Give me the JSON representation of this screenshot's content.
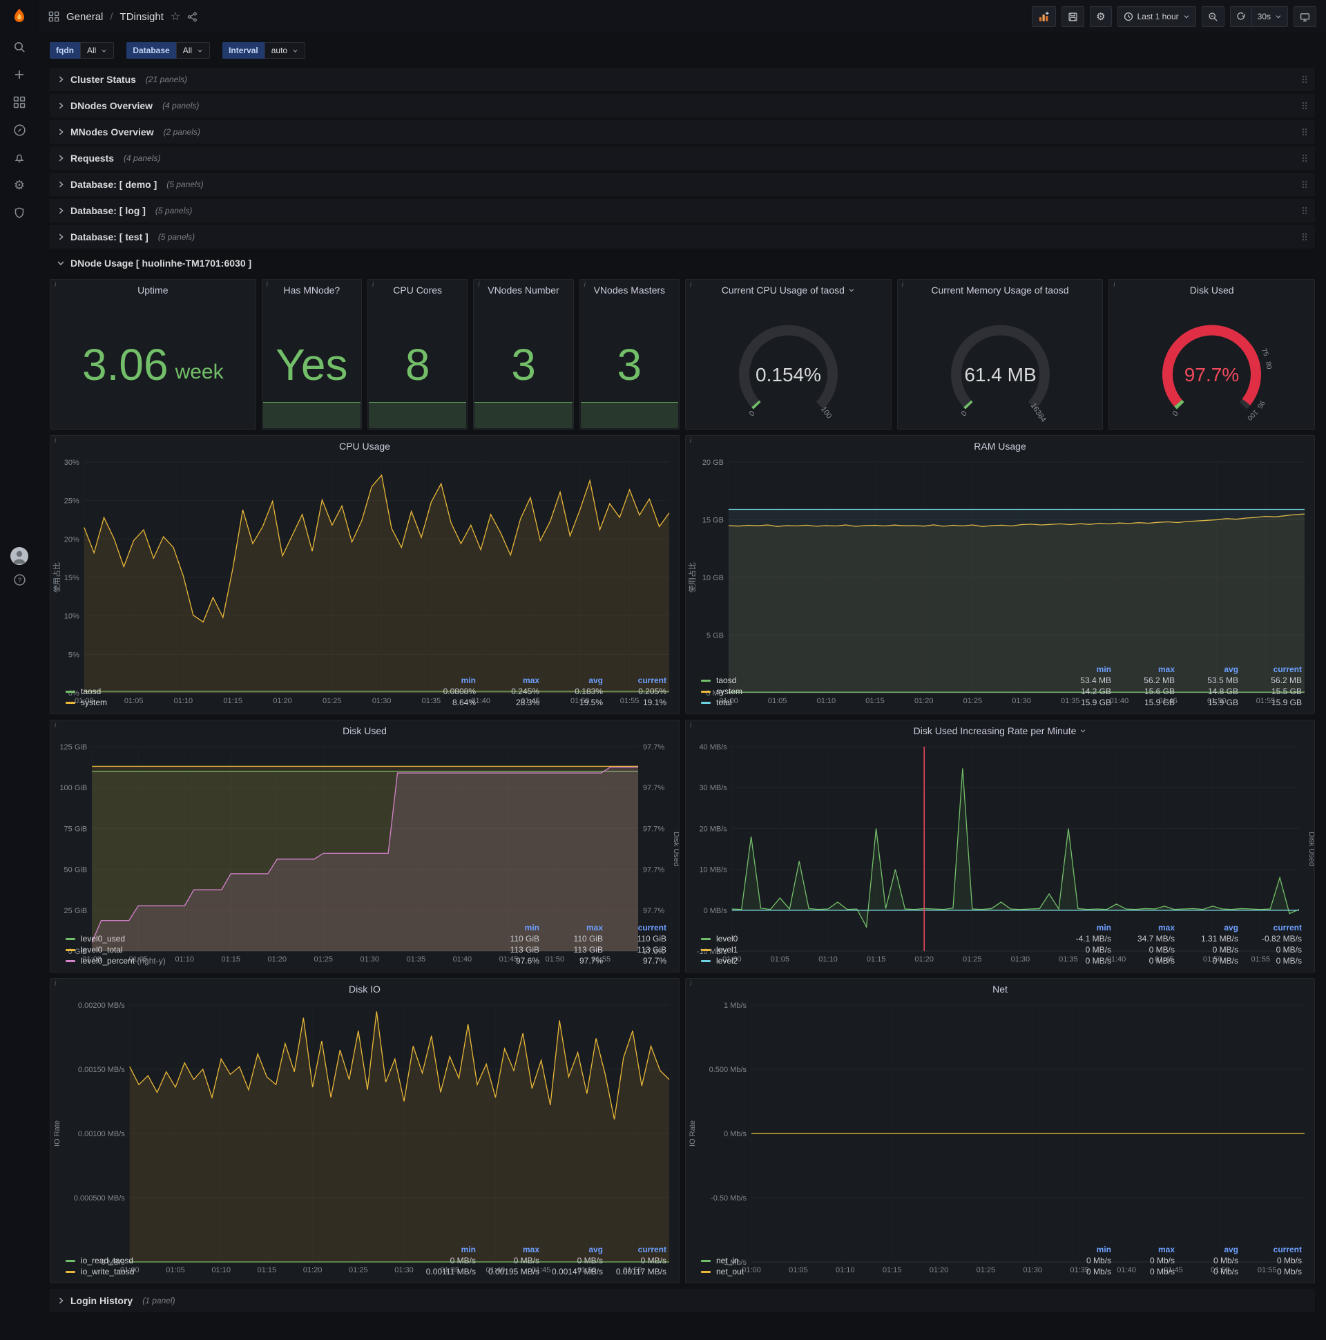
{
  "nav": {
    "breadcrumb": {
      "section": "General",
      "separator": "/",
      "page": "TDinsight"
    },
    "time_range": "Last 1 hour",
    "refresh": "30s"
  },
  "filters": [
    {
      "label": "fqdn",
      "value": "All"
    },
    {
      "label": "Database",
      "value": "All"
    },
    {
      "label": "Interval",
      "value": "auto"
    }
  ],
  "rows": [
    {
      "title": "Cluster Status",
      "count": "(21 panels)"
    },
    {
      "title": "DNodes Overview",
      "count": "(4 panels)"
    },
    {
      "title": "MNodes Overview",
      "count": "(2 panels)"
    },
    {
      "title": "Requests",
      "count": "(4 panels)"
    },
    {
      "title": "Database: [ demo ]",
      "count": "(5 panels)"
    },
    {
      "title": "Database: [ log ]",
      "count": "(5 panels)"
    },
    {
      "title": "Database: [ test ]",
      "count": "(5 panels)"
    }
  ],
  "dnode_row": {
    "title": "DNode Usage [ huolinhe-TM1701:6030 ]"
  },
  "footer_row": {
    "title": "Login History",
    "count": "(1 panel)"
  },
  "stats": [
    {
      "title": "Uptime",
      "value": "3.06",
      "suffix": "week"
    },
    {
      "title": "Has MNode?",
      "value": "Yes"
    },
    {
      "title": "CPU Cores",
      "value": "8"
    },
    {
      "title": "VNodes Number",
      "value": "3"
    },
    {
      "title": "VNodes Masters",
      "value": "3"
    }
  ],
  "gauges": [
    {
      "title": "Current CPU Usage of taosd",
      "value": "0.154%",
      "min_label": "0",
      "max_label": "100",
      "fraction": 0.00154,
      "color": "#73bf69"
    },
    {
      "title": "Current Memory Usage of taosd",
      "value": "61.4 MB",
      "min_label": "0",
      "max_label": "16384",
      "fraction": 0.0037,
      "color": "#73bf69"
    },
    {
      "title": "Disk Used",
      "value": "97.7%",
      "value_color": "#f2495c",
      "min_label": "0",
      "max_label": "",
      "fraction": 0.977,
      "color": "#e02f44",
      "start_color": "#73bf69",
      "thresholds": [
        {
          "label": "75",
          "frac": 0.75
        },
        {
          "label": "80",
          "frac": 0.8
        },
        {
          "label": "95",
          "frac": 0.95
        },
        {
          "label": "100",
          "frac": 1.0
        }
      ]
    }
  ],
  "chart_data": [
    {
      "id": "cpu_usage",
      "type": "line",
      "title": "CPU Usage",
      "ylabel": "使用占比",
      "ylim": [
        0,
        30
      ],
      "y_ticks": [
        "0%",
        "5%",
        "10%",
        "15%",
        "20%",
        "25%",
        "30%"
      ],
      "x_count": 60,
      "x_ticks": [
        "01:00",
        "01:05",
        "01:10",
        "01:15",
        "01:20",
        "01:25",
        "01:30",
        "01:35",
        "01:40",
        "01:45",
        "01:50",
        "01:55"
      ],
      "series": [
        {
          "name": "taosd",
          "color": "#73bf69",
          "fill": 0.1,
          "const": 0.2
        },
        {
          "name": "system",
          "color": "#eab839",
          "fill": 0.12,
          "values": [
            21.5,
            18.2,
            22.8,
            20.1,
            16.4,
            19.8,
            21.2,
            17.5,
            20.3,
            18.9,
            15.2,
            10.1,
            9.2,
            12.4,
            9.8,
            16.2,
            23.8,
            19.4,
            21.6,
            24.9,
            17.8,
            20.5,
            23.2,
            18.4,
            25.1,
            21.8,
            24.3,
            19.6,
            22.4,
            26.8,
            28.3,
            21.4,
            18.9,
            23.6,
            20.2,
            24.8,
            27.2,
            22.1,
            19.4,
            21.8,
            18.6,
            23.2,
            20.8,
            17.9,
            22.6,
            25.4,
            19.8,
            22.3,
            26.1,
            20.4,
            23.8,
            27.6,
            21.2,
            24.6,
            22.8,
            26.4,
            23.1,
            25.2,
            21.6,
            23.4
          ]
        }
      ],
      "legend": {
        "columns": [
          "min",
          "max",
          "avg",
          "current"
        ],
        "rows": [
          {
            "name": "taosd",
            "color": "#73bf69",
            "values": [
              "0.0808%",
              "0.245%",
              "0.183%",
              "0.205%"
            ]
          },
          {
            "name": "system",
            "color": "#eab839",
            "values": [
              "8.64%",
              "28.3%",
              "19.5%",
              "19.1%"
            ]
          }
        ]
      }
    },
    {
      "id": "ram_usage",
      "type": "line",
      "title": "RAM Usage",
      "ylabel": "使用占比",
      "ylim": [
        0,
        20
      ],
      "y_ticks": [
        "0 MB",
        "5 GB",
        "10 GB",
        "15 GB",
        "20 GB"
      ],
      "x_count": 60,
      "x_ticks": [
        "01:00",
        "01:05",
        "01:10",
        "01:15",
        "01:20",
        "01:25",
        "01:30",
        "01:35",
        "01:40",
        "01:45",
        "01:50",
        "01:55"
      ],
      "series": [
        {
          "name": "taosd",
          "color": "#73bf69",
          "fill": 0.1,
          "const": 0.053
        },
        {
          "name": "system",
          "color": "#eab839",
          "fill": 0.08,
          "values": [
            14.5,
            14.45,
            14.52,
            14.48,
            14.55,
            14.42,
            14.5,
            14.47,
            14.53,
            14.44,
            14.5,
            14.46,
            14.55,
            14.43,
            14.5,
            14.52,
            14.46,
            14.54,
            14.48,
            14.5,
            14.45,
            14.56,
            14.44,
            14.52,
            14.47,
            14.55,
            14.42,
            14.5,
            14.53,
            14.46,
            14.58,
            14.62,
            14.55,
            14.6,
            14.65,
            14.58,
            14.66,
            14.6,
            14.7,
            14.64,
            14.72,
            14.68,
            14.75,
            14.7,
            14.78,
            14.82,
            14.76,
            14.85,
            14.9,
            14.95,
            15.0,
            15.1,
            15.05,
            15.15,
            15.2,
            15.3,
            15.25,
            15.35,
            15.45,
            15.5
          ]
        },
        {
          "name": "total",
          "color": "#6ed0e0",
          "fill": 0.08,
          "const": 15.9
        }
      ],
      "legend": {
        "columns": [
          "min",
          "max",
          "avg",
          "current"
        ],
        "rows": [
          {
            "name": "taosd",
            "color": "#73bf69",
            "values": [
              "53.4 MB",
              "56.2 MB",
              "53.5 MB",
              "56.2 MB"
            ]
          },
          {
            "name": "system",
            "color": "#eab839",
            "values": [
              "14.2 GB",
              "15.6 GB",
              "14.8 GB",
              "15.5 GB"
            ]
          },
          {
            "name": "total",
            "color": "#6ed0e0",
            "values": [
              "15.9 GB",
              "15.9 GB",
              "15.9 GB",
              "15.9 GB"
            ]
          }
        ]
      }
    },
    {
      "id": "disk_used",
      "type": "line",
      "title": "Disk Used",
      "ylim": [
        0,
        125
      ],
      "y_ticks": [
        "0 GiB",
        "25 GiB",
        "50 GiB",
        "75 GiB",
        "100 GiB",
        "125 GiB"
      ],
      "right_ylim": [
        97.6,
        97.74
      ],
      "right_ticks": [
        "97.6%",
        "97.7%",
        "97.7%",
        "97.7%",
        "97.7%",
        "97.7%"
      ],
      "right_label": "Disk Used",
      "x_count": 60,
      "x_ticks": [
        "01:00",
        "01:05",
        "01:10",
        "01:15",
        "01:20",
        "01:25",
        "01:30",
        "01:35",
        "01:40",
        "01:45",
        "01:50",
        "01:55"
      ],
      "series": [
        {
          "name": "level0_used",
          "color": "#73bf69",
          "fill": 0.1,
          "const": 110
        },
        {
          "name": "level0_total",
          "color": "#eab839",
          "fill": 0.12,
          "const": 113
        },
        {
          "name": "level0_percent",
          "color": "#d683ce",
          "fill": 0.15,
          "axis": "right",
          "values": [
            97.606,
            97.621,
            97.621,
            97.621,
            97.621,
            97.631,
            97.631,
            97.631,
            97.631,
            97.631,
            97.631,
            97.642,
            97.642,
            97.642,
            97.642,
            97.653,
            97.653,
            97.653,
            97.653,
            97.653,
            97.663,
            97.663,
            97.663,
            97.663,
            97.663,
            97.667,
            97.667,
            97.667,
            97.667,
            97.667,
            97.667,
            97.667,
            97.667,
            97.722,
            97.722,
            97.722,
            97.722,
            97.722,
            97.722,
            97.722,
            97.722,
            97.722,
            97.722,
            97.722,
            97.722,
            97.722,
            97.722,
            97.722,
            97.722,
            97.722,
            97.722,
            97.722,
            97.722,
            97.722,
            97.722,
            97.722,
            97.726,
            97.726,
            97.726,
            97.726
          ]
        }
      ],
      "legend": {
        "columns": [
          "min",
          "max",
          "current"
        ],
        "rows": [
          {
            "name": "level0_used",
            "color": "#73bf69",
            "values": [
              "110 GiB",
              "110 GiB",
              "110 GiB"
            ]
          },
          {
            "name": "level0_total",
            "color": "#eab839",
            "values": [
              "113 GiB",
              "113 GiB",
              "113 GiB"
            ]
          },
          {
            "name": "level0_percent",
            "suffix": "(right-y)",
            "color": "#d683ce",
            "values": [
              "97.6%",
              "97.7%",
              "97.7%"
            ]
          }
        ]
      }
    },
    {
      "id": "disk_rate",
      "type": "line",
      "title": "Disk Used Increasing Rate per Minute",
      "menu": true,
      "ylim": [
        -10,
        40
      ],
      "y_ticks": [
        "-10 MB/s",
        "0 MB/s",
        "10 MB/s",
        "20 MB/s",
        "30 MB/s",
        "40 MB/s"
      ],
      "right_label": "Disk Used",
      "annotation": {
        "x_index": 20,
        "color": "#f2495c"
      },
      "x_count": 60,
      "x_ticks": [
        "01:00",
        "01:05",
        "01:10",
        "01:15",
        "01:20",
        "01:25",
        "01:30",
        "01:35",
        "01:40",
        "01:45",
        "01:50",
        "01:55"
      ],
      "series": [
        {
          "name": "level0",
          "color": "#73bf69",
          "fill": 0.1,
          "values": [
            0.3,
            0.2,
            18,
            0.5,
            0.2,
            3,
            0.3,
            12,
            0.4,
            0.2,
            0.3,
            2,
            0.2,
            0.3,
            -4.1,
            20,
            0.4,
            10,
            0.3,
            0.2,
            0.4,
            0.3,
            0.2,
            0.5,
            34.7,
            0.3,
            0.2,
            0.4,
            2,
            0.3,
            0.2,
            0.3,
            0.4,
            4,
            0.3,
            20,
            0.4,
            0.2,
            0.3,
            0.2,
            1.5,
            0.3,
            0.2,
            0.4,
            0.3,
            1,
            0.2,
            0.3,
            0.4,
            0.2,
            1,
            0.3,
            0.2,
            0.4,
            0.3,
            0.2,
            0.3,
            8,
            -0.82,
            0.2
          ]
        },
        {
          "name": "level1",
          "color": "#eab839",
          "const": 0
        },
        {
          "name": "level2",
          "color": "#6ed0e0",
          "const": 0
        }
      ],
      "legend": {
        "columns": [
          "min",
          "max",
          "avg",
          "current"
        ],
        "rows": [
          {
            "name": "level0",
            "color": "#73bf69",
            "values": [
              "-4.1 MB/s",
              "34.7 MB/s",
              "1.31 MB/s",
              "-0.82 MB/s"
            ]
          },
          {
            "name": "level1",
            "color": "#eab839",
            "values": [
              "0 MB/s",
              "0 MB/s",
              "0 MB/s",
              "0 MB/s"
            ]
          },
          {
            "name": "level2",
            "color": "#6ed0e0",
            "values": [
              "0 MB/s",
              "0 MB/s",
              "0 MB/s",
              "0 MB/s"
            ]
          }
        ]
      }
    },
    {
      "id": "disk_io",
      "type": "line",
      "title": "Disk IO",
      "ylabel": "IO Rate",
      "ylim": [
        0,
        0.002
      ],
      "y_ticks": [
        "0 MB/s",
        "0.000500 MB/s",
        "0.00100 MB/s",
        "0.00150 MB/s",
        "0.00200 MB/s"
      ],
      "x_count": 60,
      "x_ticks": [
        "01:00",
        "01:05",
        "01:10",
        "01:15",
        "01:20",
        "01:25",
        "01:30",
        "01:35",
        "01:40",
        "01:45",
        "01:50",
        "01:55"
      ],
      "series": [
        {
          "name": "io_read_taosd",
          "color": "#73bf69",
          "fill": 0.1,
          "const": 0
        },
        {
          "name": "io_write_taosd",
          "color": "#eab839",
          "fill": 0.12,
          "values": [
            0.00152,
            0.00138,
            0.00145,
            0.00132,
            0.00148,
            0.00136,
            0.00155,
            0.00142,
            0.0015,
            0.00128,
            0.00158,
            0.00146,
            0.00152,
            0.00134,
            0.00162,
            0.00144,
            0.00138,
            0.0017,
            0.00148,
            0.0019,
            0.00136,
            0.00172,
            0.00128,
            0.00165,
            0.00142,
            0.0018,
            0.00134,
            0.00195,
            0.0014,
            0.00158,
            0.00125,
            0.00168,
            0.00147,
            0.00176,
            0.00132,
            0.0016,
            0.00143,
            0.00185,
            0.00138,
            0.00154,
            0.00128,
            0.00166,
            0.00149,
            0.00178,
            0.00135,
            0.00157,
            0.00122,
            0.00188,
            0.00144,
            0.00163,
            0.00131,
            0.00174,
            0.00146,
            0.00111,
            0.00159,
            0.0018,
            0.00137,
            0.00168,
            0.00149,
            0.00142
          ]
        }
      ],
      "legend": {
        "columns": [
          "min",
          "max",
          "avg",
          "current"
        ],
        "rows": [
          {
            "name": "io_read_taosd",
            "color": "#73bf69",
            "values": [
              "0 MB/s",
              "0 MB/s",
              "0 MB/s",
              "0 MB/s"
            ]
          },
          {
            "name": "io_write_taosd",
            "color": "#eab839",
            "values": [
              "0.00111 MB/s",
              "0.00195 MB/s",
              "0.00147 MB/s",
              "0.00117 MB/s"
            ]
          }
        ]
      }
    },
    {
      "id": "net",
      "type": "line",
      "title": "Net",
      "ylabel": "IO Rate",
      "ylim": [
        -1,
        1
      ],
      "y_ticks": [
        "-1 Mb/s",
        "-0.50 Mb/s",
        "0 Mb/s",
        "0.500 Mb/s",
        "1 Mb/s"
      ],
      "x_count": 60,
      "x_ticks": [
        "01:00",
        "01:05",
        "01:10",
        "01:15",
        "01:20",
        "01:25",
        "01:30",
        "01:35",
        "01:40",
        "01:45",
        "01:50",
        "01:55"
      ],
      "series": [
        {
          "name": "net_in",
          "color": "#73bf69",
          "const": 0
        },
        {
          "name": "net_out",
          "color": "#eab839",
          "const": 0
        }
      ],
      "legend": {
        "columns": [
          "min",
          "max",
          "avg",
          "current"
        ],
        "rows": [
          {
            "name": "net_in",
            "color": "#73bf69",
            "values": [
              "0 Mb/s",
              "0 Mb/s",
              "0 Mb/s",
              "0 Mb/s"
            ]
          },
          {
            "name": "net_out",
            "color": "#eab839",
            "values": [
              "0 Mb/s",
              "0 Mb/s",
              "0 Mb/s",
              "0 Mb/s"
            ]
          }
        ]
      }
    }
  ]
}
